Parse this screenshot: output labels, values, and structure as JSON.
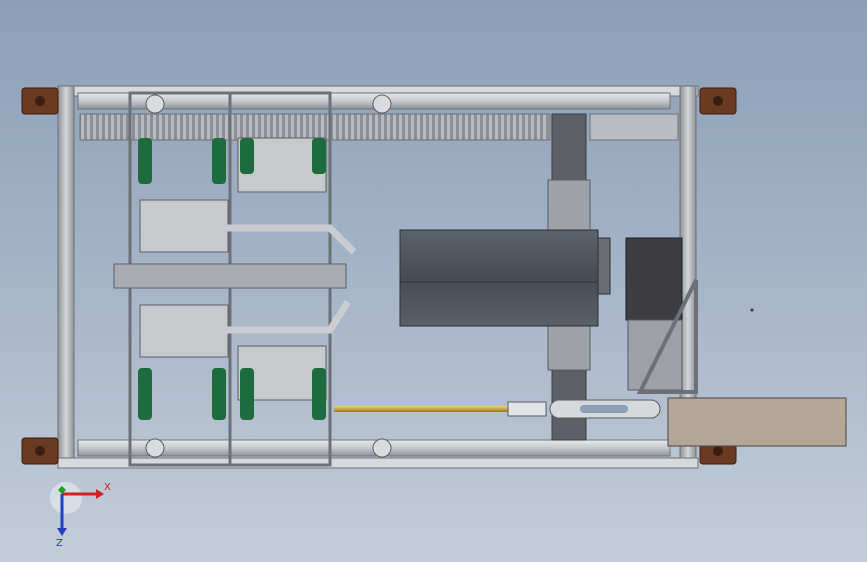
{
  "view": {
    "triad": {
      "x_label": "X",
      "z_label": "Z",
      "x_color": "#d22020",
      "y_color": "#20a020",
      "z_color": "#2040c0"
    }
  },
  "colors": {
    "background_top": "#8b9fb7",
    "background_bottom": "#c4cdd9",
    "frame": "#c9ccd0",
    "frame_dark": "#7e8288",
    "bracket_brown": "#6b3a22",
    "roller_green": "#1f6b40",
    "motor_body": "#4a4f58",
    "gear_motor": "#3e3e42",
    "connecting_rod": "#c8a14a",
    "guide_column": "#5c5f64"
  }
}
